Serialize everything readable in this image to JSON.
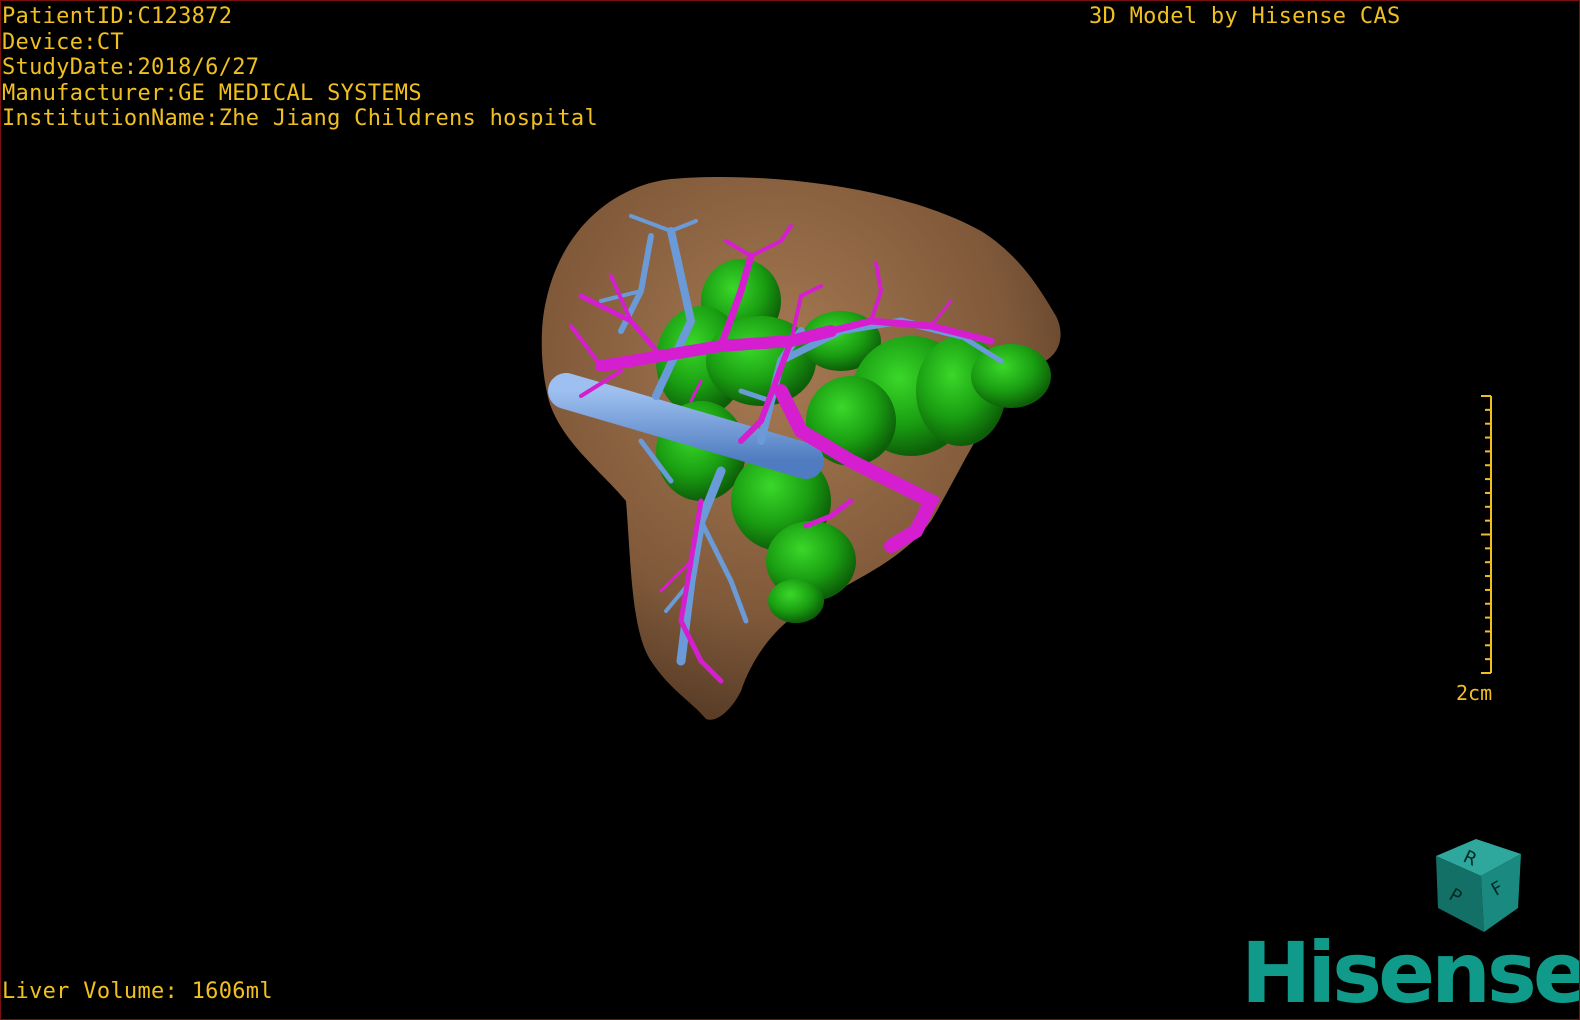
{
  "patient": {
    "id_line": "PatientID:C123872",
    "device_line": "Device:CT",
    "study_date_line": "StudyDate:2018/6/27",
    "manufacturer_line": "Manufacturer:GE MEDICAL SYSTEMS",
    "institution_line": "InstitutionName:Zhe Jiang Childrens hospital"
  },
  "header": {
    "model_credit": "3D Model by Hisense CAS"
  },
  "footer": {
    "liver_volume": "Liver Volume: 1606ml"
  },
  "scale_bar": {
    "label": "2cm"
  },
  "orientation_cube": {
    "face_labels": [
      "R",
      "F",
      "P"
    ],
    "color": "#1a8a80"
  },
  "brand": {
    "logo_text": "Hisense",
    "color": "#0f9a8a"
  },
  "model": {
    "liver_color": "#8a6240",
    "lesion_color": "#1c9e14",
    "portal_vein_color": "#6b9ad8",
    "hepatic_artery_color": "#d41ed0",
    "overlay_text_color": "#f0c020",
    "structures": [
      "liver",
      "lesion",
      "portal-vein",
      "hepatic-vessels"
    ]
  }
}
